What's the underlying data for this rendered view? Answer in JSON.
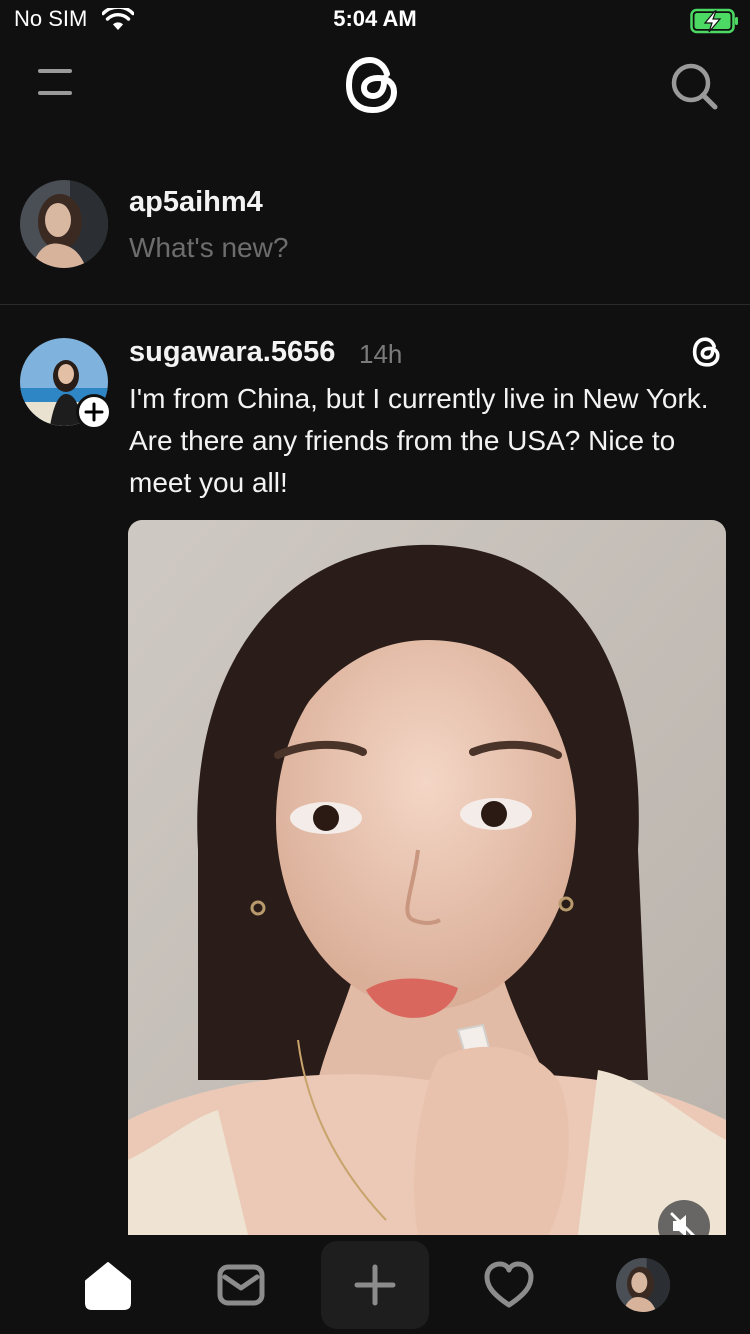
{
  "status_bar": {
    "carrier": "No SIM",
    "time": "5:04 AM"
  },
  "header": {
    "menu_icon": "menu-icon",
    "logo_icon": "threads-logo",
    "search_icon": "search-icon"
  },
  "composer": {
    "username": "ap5aihm4",
    "placeholder": "What's new?"
  },
  "post": {
    "username": "sugawara.5656",
    "time": "14h",
    "text": "I'm from China, but I currently live in New York. Are there any friends from the USA? Nice to meet you all!"
  },
  "tab_bar": {
    "items": [
      "home-icon",
      "inbox-icon",
      "compose-icon",
      "activity-icon",
      "profile-avatar"
    ]
  },
  "colors": {
    "background": "#101010",
    "text": "#f3f3f3",
    "muted": "#6d6d6d",
    "divider": "#2a2a2a",
    "battery": "#4cd964"
  }
}
